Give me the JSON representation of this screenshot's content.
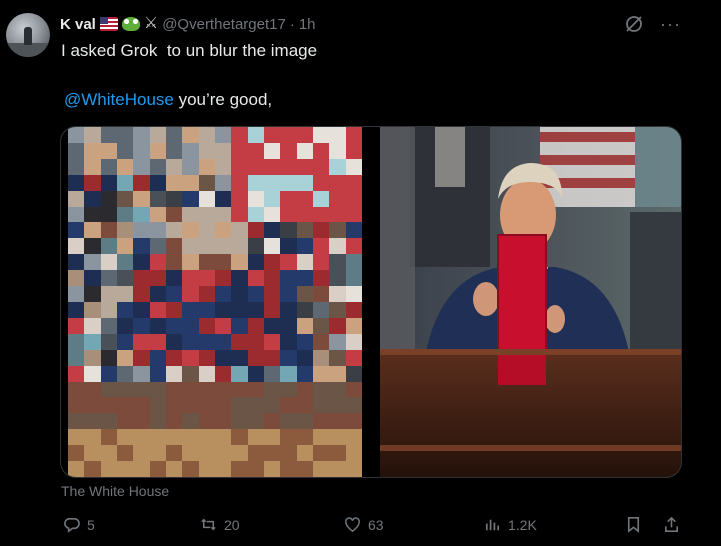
{
  "author": {
    "display_name": "K val",
    "emojis": [
      "us-flag-icon",
      "frog-icon",
      "crossed-swords-icon"
    ],
    "handle": "@Qverthetarget17",
    "separator": "·",
    "time": "1h"
  },
  "post": {
    "text": "I asked Grok  to un blur the image",
    "mention": "@WhiteHouse",
    "reply_text": " you’re good,"
  },
  "media": {
    "left_image": "pixelated-image",
    "right_image": "man-at-desk-holding-red-folder",
    "source_label": "The White House"
  },
  "actions": {
    "replies": "5",
    "reposts": "20",
    "likes": "63",
    "views": "1.2K"
  },
  "colors": {
    "background": "#000000",
    "text": "#e7e9ea",
    "muted": "#71767b",
    "link": "#1d9bf0"
  }
}
